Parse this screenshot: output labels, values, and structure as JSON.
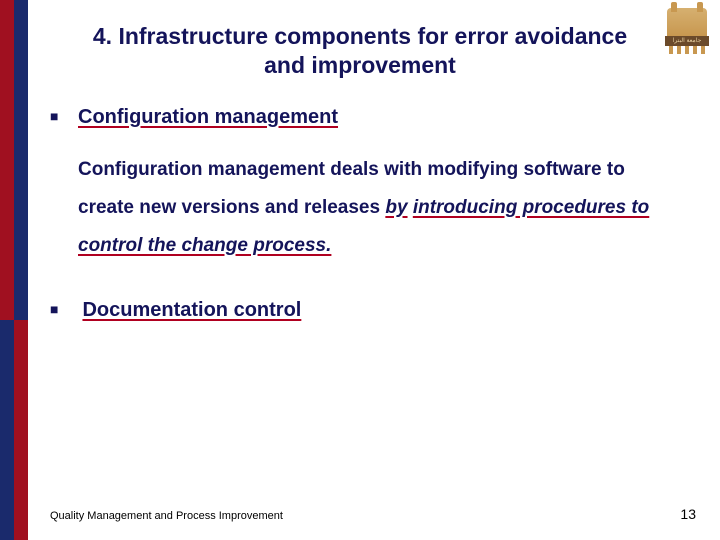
{
  "logo": {
    "text": "جامعة البترا"
  },
  "title": "4. Infrastructure components for error avoidance and improvement",
  "bullets": [
    {
      "head": "Configuration management",
      "body_plain": "Configuration management deals with modifying software to create new versions and releases ",
      "body_by": "by",
      "body_tail": "introducing procedures to control the change process."
    },
    {
      "head": "Documentation control"
    }
  ],
  "footer": {
    "left": "Quality Management and Process Improvement",
    "page": "13"
  }
}
